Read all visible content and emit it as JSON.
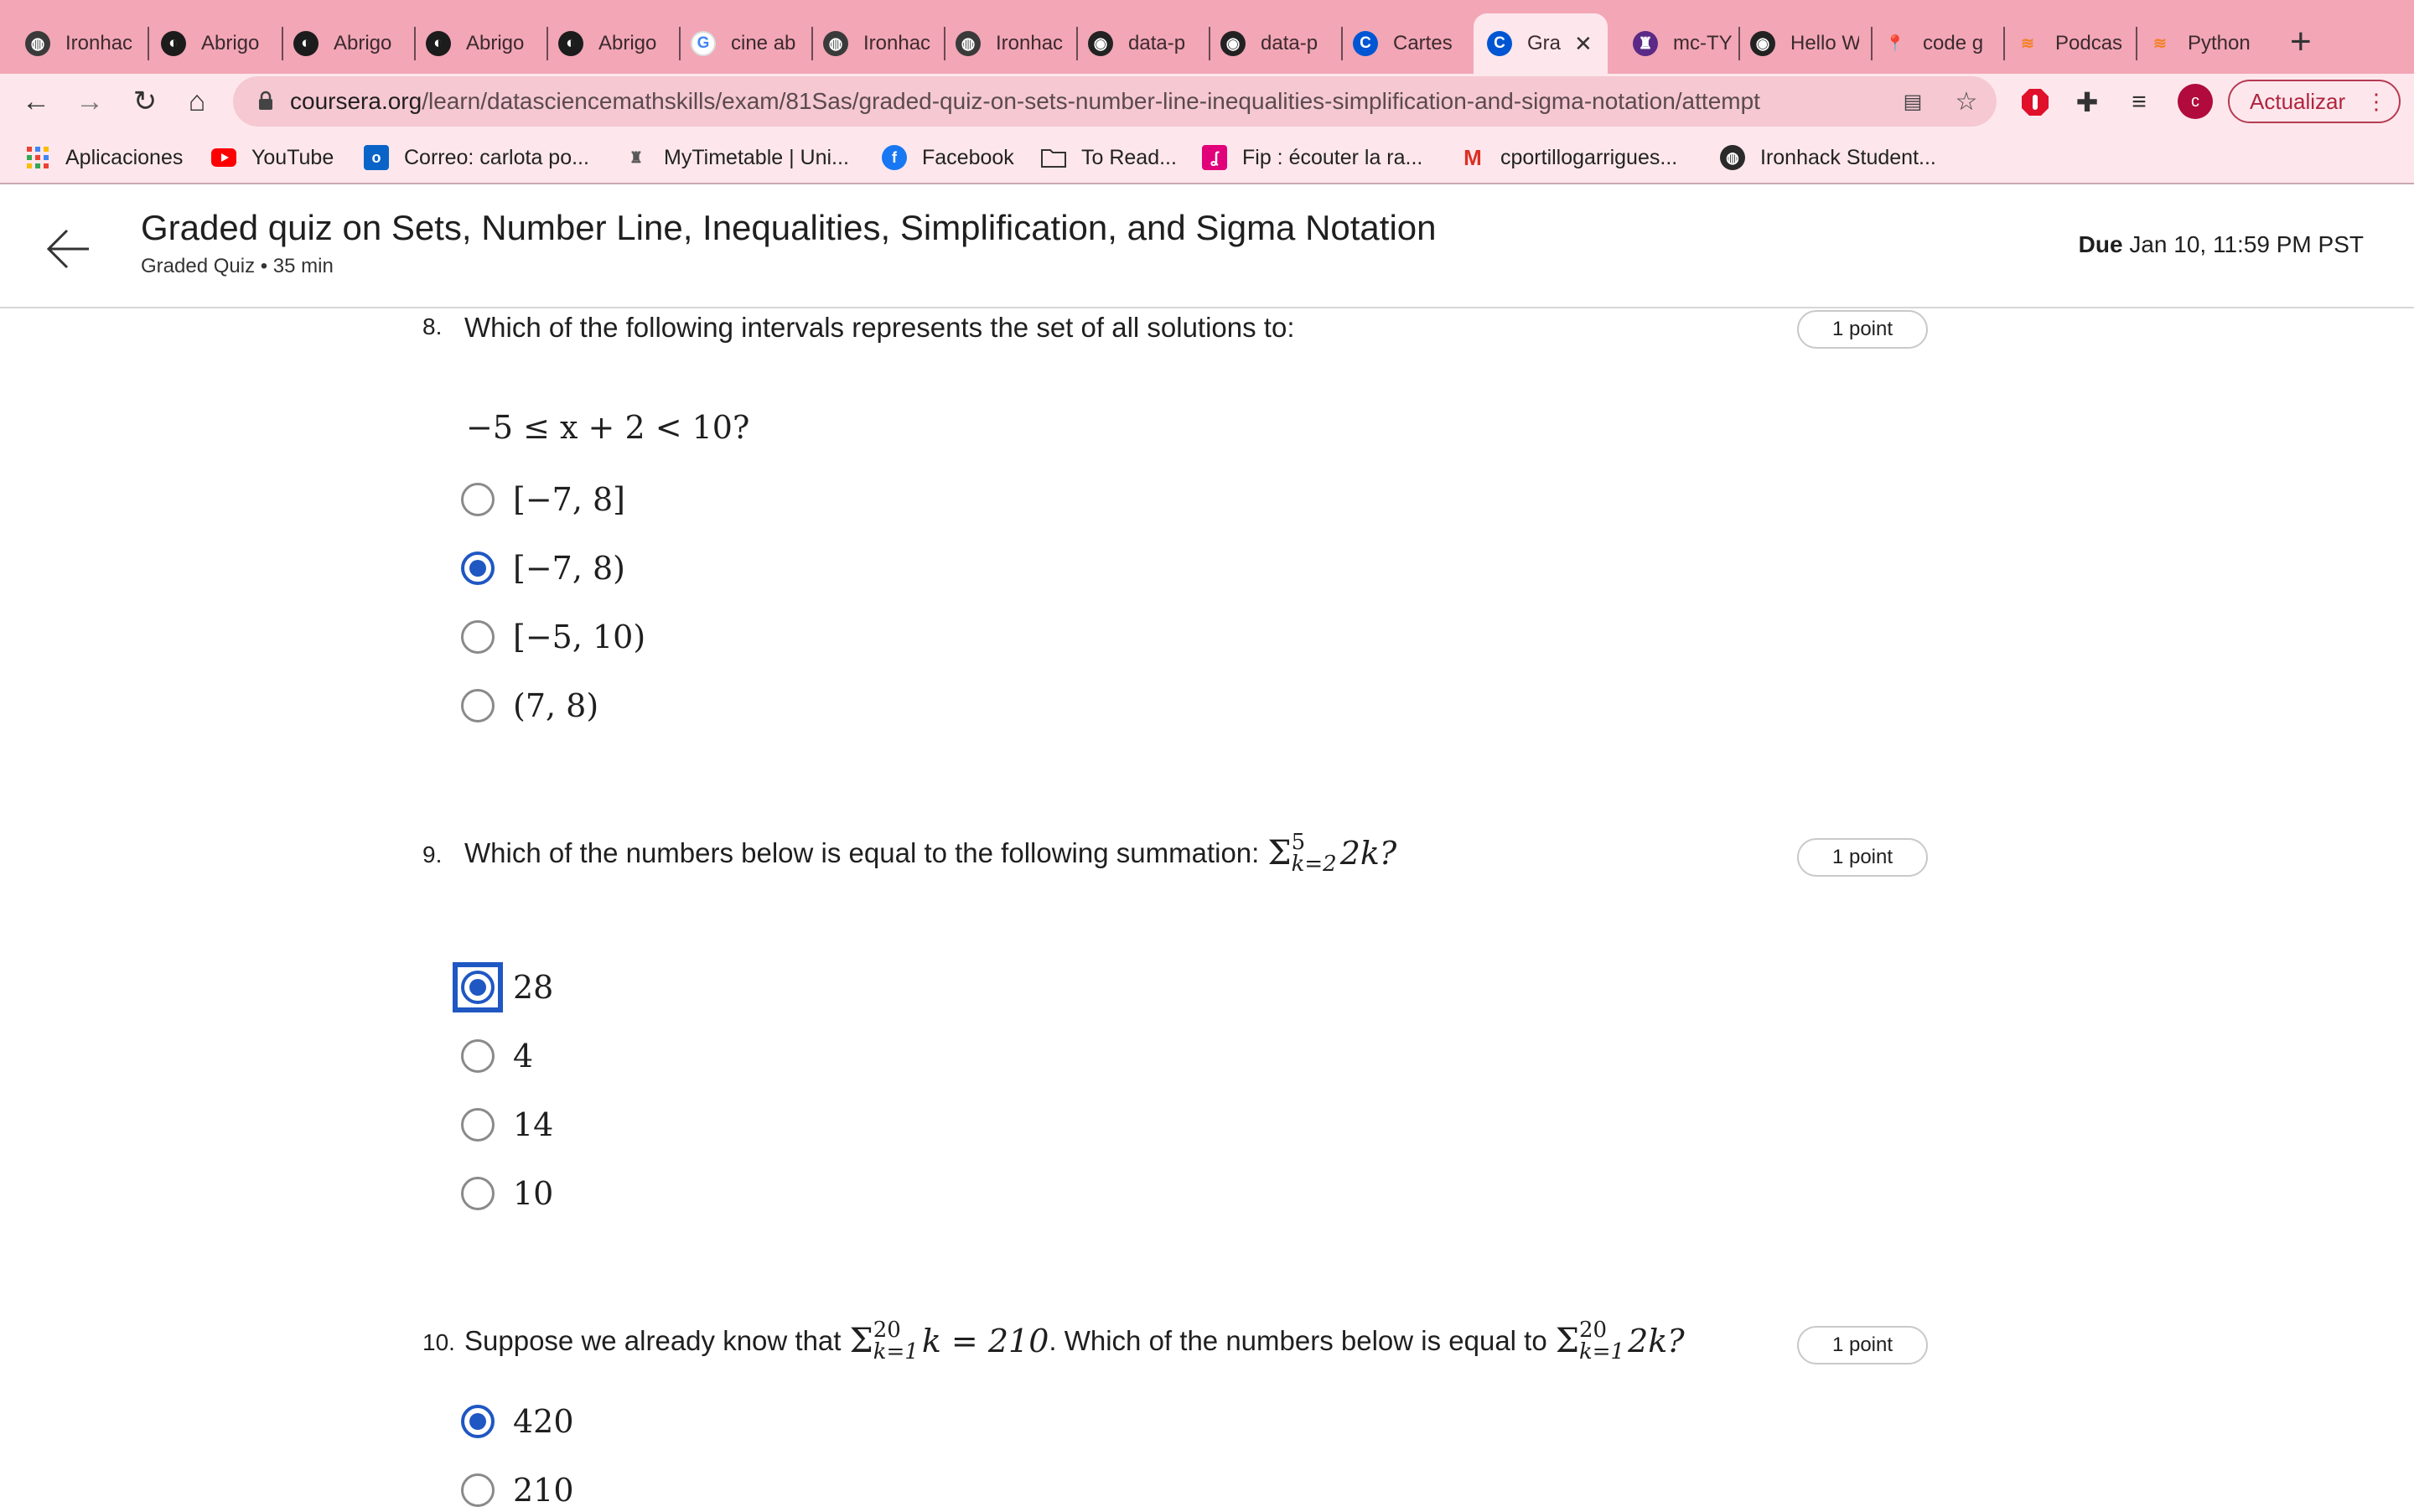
{
  "browser": {
    "tabs": [
      {
        "label": "Ironhac",
        "icon": "globe-icon"
      },
      {
        "label": "Abrigo",
        "icon": "dark-logo-icon"
      },
      {
        "label": "Abrigo",
        "icon": "dark-logo-icon"
      },
      {
        "label": "Abrigo",
        "icon": "dark-logo-icon"
      },
      {
        "label": "Abrigo",
        "icon": "dark-logo-icon"
      },
      {
        "label": "cine ab",
        "icon": "google-icon"
      },
      {
        "label": "Ironhac",
        "icon": "globe-icon"
      },
      {
        "label": "Ironhac",
        "icon": "globe-icon"
      },
      {
        "label": "data-p",
        "icon": "github-icon"
      },
      {
        "label": "data-p",
        "icon": "github-icon"
      },
      {
        "label": "Cartes",
        "icon": "coursera-icon"
      },
      {
        "label": "Gra",
        "icon": "coursera-icon",
        "active": true
      },
      {
        "label": "mc-TY",
        "icon": "shield-crest-icon"
      },
      {
        "label": "Hello W",
        "icon": "github-icon"
      },
      {
        "label": "code g",
        "icon": "maps-pin-icon"
      },
      {
        "label": "Podcas",
        "icon": "stack-icon"
      },
      {
        "label": "Python",
        "icon": "stack-icon"
      }
    ],
    "new_tab": "+",
    "url_host": "coursera.org",
    "url_path": "/learn/datasciencemathskills/exam/81Sas/graded-quiz-on-sets-number-line-inequalities-simplification-and-sigma-notation/attempt",
    "profile_initial": "c",
    "update_label": "Actualizar",
    "bookmarks": [
      {
        "label": "Aplicaciones",
        "icon": "apps-grid-icon"
      },
      {
        "label": "YouTube",
        "icon": "youtube-icon"
      },
      {
        "label": "Correo: carlota po...",
        "icon": "outlook-icon"
      },
      {
        "label": "MyTimetable | Uni...",
        "icon": "crest-icon"
      },
      {
        "label": "Facebook",
        "icon": "facebook-icon"
      },
      {
        "label": "To Read...",
        "icon": "folder-icon"
      },
      {
        "label": "Fip : écouter la ra...",
        "icon": "fip-icon"
      },
      {
        "label": "cportillogarrigues...",
        "icon": "gmail-icon"
      },
      {
        "label": "Ironhack Student...",
        "icon": "globe-icon"
      }
    ]
  },
  "header": {
    "title": "Graded quiz on Sets, Number Line, Inequalities, Simplification, and Sigma Notation",
    "subtitle": "Graded Quiz • 35 min",
    "due_label": "Due",
    "due_value": "Jan 10, 11:59 PM PST"
  },
  "questions": [
    {
      "number": "8.",
      "text": "Which of the following intervals represents the set of all solutions to:",
      "formula": "−5 ≤ x + 2 < 10?",
      "points": "1 point",
      "options": [
        {
          "label": "[−7, 8]",
          "selected": false
        },
        {
          "label": "[−7, 8)",
          "selected": true
        },
        {
          "label": "[−5, 10)",
          "selected": false
        },
        {
          "label": "(7, 8)",
          "selected": false
        }
      ]
    },
    {
      "number": "9.",
      "text": "Which of the numbers below is equal to the following summation:",
      "sum_upper": "5",
      "sum_lower": "k=2",
      "sum_body": "2k?",
      "points": "1 point",
      "options": [
        {
          "label": "28",
          "selected": true
        },
        {
          "label": "4",
          "selected": false
        },
        {
          "label": "14",
          "selected": false
        },
        {
          "label": "10",
          "selected": false
        }
      ]
    },
    {
      "number": "10.",
      "text_a": "Suppose we already know that",
      "sum1_upper": "20",
      "sum1_lower": "k=1",
      "sum1_body": "k = 210",
      "text_b": ". Which of the numbers below is equal to",
      "sum2_upper": "20",
      "sum2_lower": "k=1",
      "sum2_body": "2k?",
      "points": "1 point",
      "options": [
        {
          "label": "420",
          "selected": true
        },
        {
          "label": "210",
          "selected": false
        }
      ]
    }
  ]
}
